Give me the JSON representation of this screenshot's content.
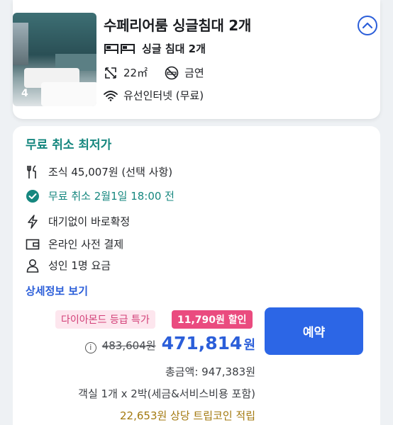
{
  "room": {
    "image_count": "4",
    "title": "수페리어룸 싱글침대 2개",
    "bed": "싱글 침대 2개",
    "area": "22㎡",
    "smoking": "금연",
    "internet": "유선인터넷 (무료)"
  },
  "offer": {
    "section_title": "무료 취소 최저가",
    "features": {
      "breakfast": "조식 45,007원 (선택 사항)",
      "cancel": "무료 취소 2월1일 18:00 전",
      "instant": "대기없이 바로확정",
      "payment": "온라인 사전 결제",
      "guests": "성인 1명 요금"
    },
    "details_link": "상세정보 보기",
    "grade_badge": "다이아몬드 등급 특가",
    "discount_badge": "11,790원 할인",
    "original_price": "483,604원",
    "final_price": "471,814",
    "final_unit": "원",
    "total": "총금액: 947,383원",
    "stay_note": "객실 1개 x 2박(세금&서비스비용 포함)",
    "coin_note": "22,653원 상당 트립코인 적립",
    "reserve_label": "예약"
  },
  "colors": {
    "accent_blue": "#2b5ed9",
    "accent_green": "#16877f",
    "discount_pink": "#ea4b7f",
    "coin_gold": "#a3790f"
  }
}
